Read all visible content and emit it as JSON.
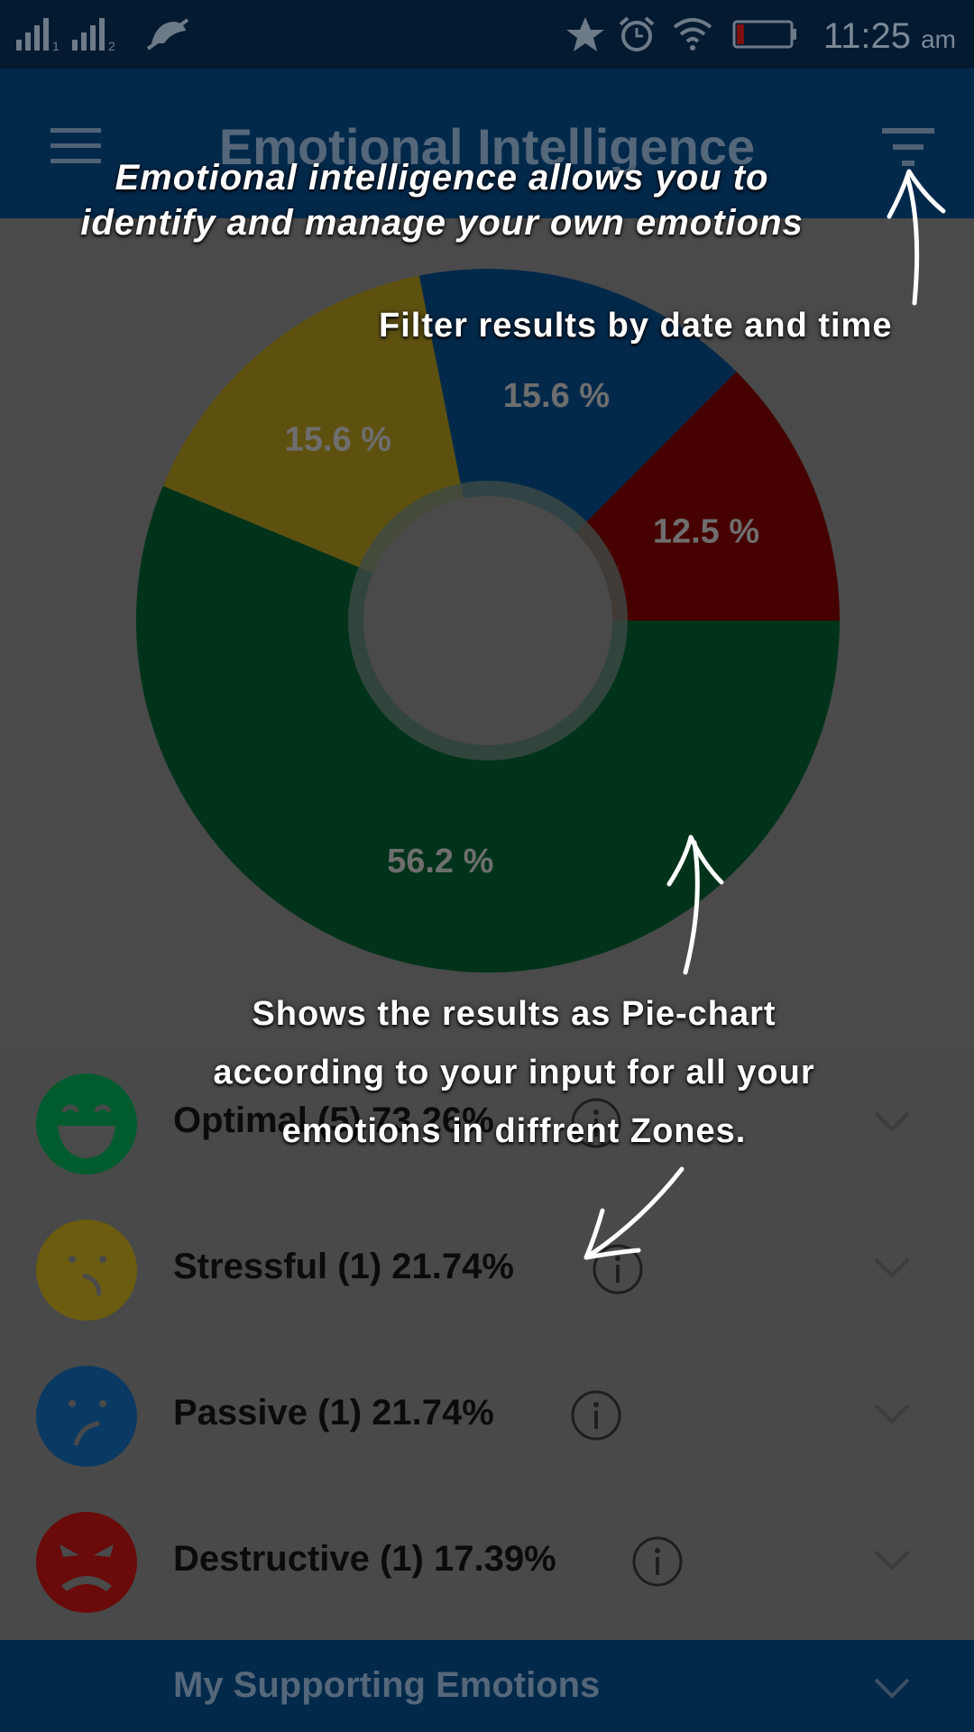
{
  "status_bar": {
    "time": "11:25",
    "ampm": "am",
    "icons": [
      "signal-1-icon",
      "signal-2-icon",
      "no-notifications-icon",
      "star-icon",
      "alarm-icon",
      "wifi-icon",
      "battery-icon"
    ]
  },
  "app_bar": {
    "title": "Emotional Intelligence",
    "menu_icon": "hamburger-menu-icon",
    "filter_icon": "filter-icon"
  },
  "chart_data": {
    "type": "pie",
    "categories": [
      "Optimal",
      "Stressful",
      "Passive",
      "Destructive"
    ],
    "values": [
      56.2,
      15.6,
      15.6,
      12.5
    ],
    "labels": [
      "56.2 %",
      "15.6 %",
      "15.6 %",
      "12.5 %"
    ],
    "colors": [
      "#00331a",
      "#5e5110",
      "#03294a",
      "#460000"
    ]
  },
  "list": {
    "items": [
      {
        "label": "Optimal (5) 73.26%",
        "color": "#005c2e",
        "face": "laughing-face-icon"
      },
      {
        "label": "Stressful (1) 21.74%",
        "color": "#6b5c10",
        "face": "worried-face-icon"
      },
      {
        "label": "Passive (1) 21.74%",
        "color": "#0a3a63",
        "face": "confused-face-icon"
      },
      {
        "label": "Destructive (1) 17.39%",
        "color": "#6a0a0a",
        "face": "angry-face-icon"
      }
    ],
    "info_icon": "info-icon",
    "expand_icon": "chevron-down-icon"
  },
  "bottom_bar": {
    "label": "My Supporting Emotions"
  },
  "overlay": {
    "intro_line1": "Emotional intelligence allows you to",
    "intro_line2": "identify and manage your own emotions",
    "filter_tip": "Filter results by date and time",
    "pie_tip_part1": "Shows the results as ",
    "pie_tip_bold1": "Pie-chart",
    "pie_tip_part2": "according to your input for all your",
    "pie_tip_part3": "emotions in diffrent ",
    "pie_tip_bold2": "Zones."
  }
}
